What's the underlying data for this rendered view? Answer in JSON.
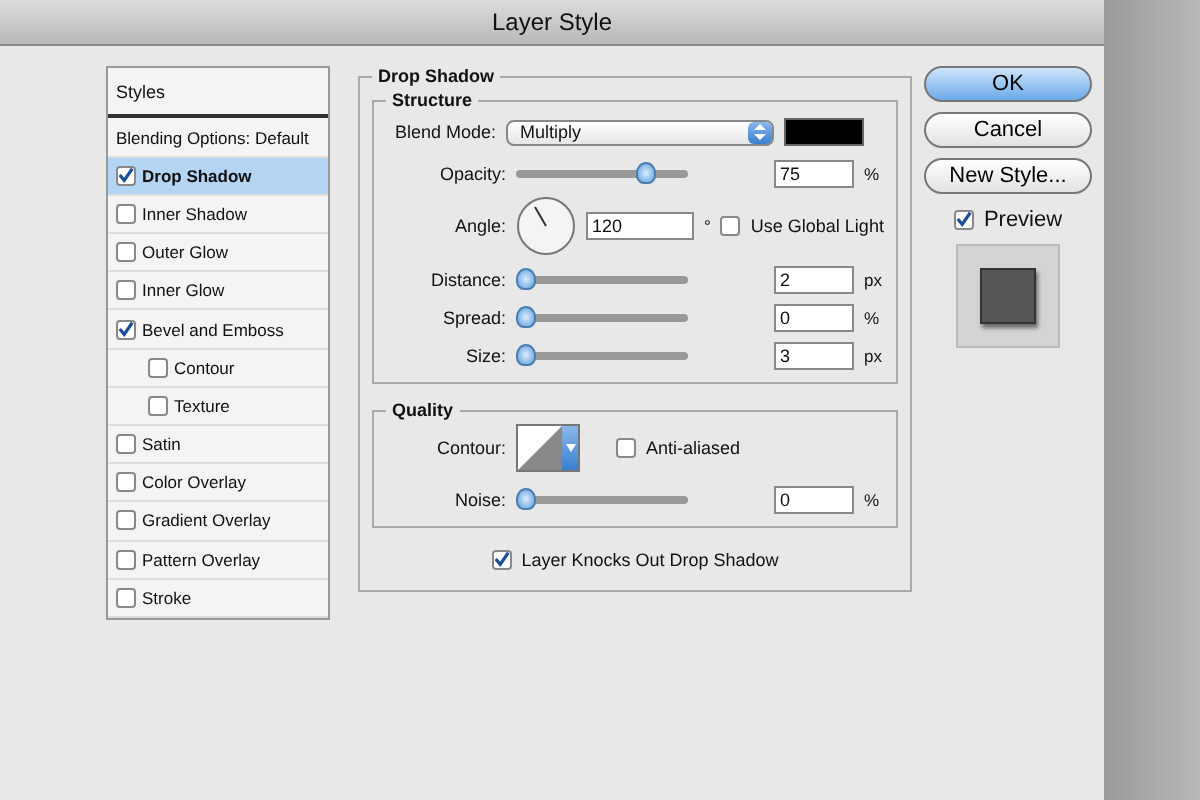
{
  "window": {
    "title": "Layer Style"
  },
  "styles_list": {
    "header": "Styles",
    "items": [
      {
        "label": "Blending Options: Default",
        "kind": "plain",
        "selected": false
      },
      {
        "label": "Drop Shadow",
        "kind": "check",
        "checked": true,
        "selected": true
      },
      {
        "label": "Inner Shadow",
        "kind": "check",
        "checked": false,
        "selected": false
      },
      {
        "label": "Outer Glow",
        "kind": "check",
        "checked": false,
        "selected": false
      },
      {
        "label": "Inner Glow",
        "kind": "check",
        "checked": false,
        "selected": false
      },
      {
        "label": "Bevel and Emboss",
        "kind": "check",
        "checked": true,
        "selected": false,
        "children": [
          {
            "label": "Contour",
            "kind": "check",
            "checked": false,
            "selected": false
          },
          {
            "label": "Texture",
            "kind": "check",
            "checked": false,
            "selected": false
          }
        ]
      },
      {
        "label": "Satin",
        "kind": "check",
        "checked": false,
        "selected": false
      },
      {
        "label": "Color Overlay",
        "kind": "check",
        "checked": false,
        "selected": false
      },
      {
        "label": "Gradient Overlay",
        "kind": "check",
        "checked": false,
        "selected": false
      },
      {
        "label": "Pattern Overlay",
        "kind": "check",
        "checked": false,
        "selected": false
      },
      {
        "label": "Stroke",
        "kind": "check",
        "checked": false,
        "selected": false
      }
    ]
  },
  "panel": {
    "title": "Drop Shadow",
    "structure": {
      "title": "Structure",
      "blend_mode": {
        "label": "Blend Mode:",
        "value": "Multiply"
      },
      "rows": [
        {
          "kind": "slider",
          "label": "Opacity:",
          "level": 0.75,
          "value": "75",
          "unit": "%"
        },
        {
          "kind": "angle",
          "label": "Angle:",
          "value": "120",
          "unit": "°",
          "option": {
            "label": "Use Global Light",
            "checked": false
          }
        },
        {
          "kind": "slider",
          "label": "Distance:",
          "level": 0.0,
          "value": "2",
          "unit": "px"
        },
        {
          "kind": "slider",
          "label": "Spread:",
          "level": 0.0,
          "value": "0",
          "unit": "%"
        },
        {
          "kind": "slider",
          "label": "Size:",
          "level": 0.02,
          "value": "3",
          "unit": "px"
        }
      ]
    },
    "quality": {
      "title": "Quality",
      "contour_label": "Contour:",
      "anti_aliased": {
        "label": "Anti-aliased",
        "checked": false
      },
      "noise": {
        "label": "Noise:",
        "level": 0.0,
        "value": "0",
        "unit": "%"
      }
    },
    "knockout": {
      "label": "Layer Knocks Out Drop Shadow",
      "checked": true
    }
  },
  "buttons": [
    {
      "label": "OK",
      "default": true
    },
    {
      "label": "Cancel",
      "default": false
    },
    {
      "label": "New Style...",
      "default": false
    }
  ],
  "preview": {
    "label": "Preview",
    "checked": true
  }
}
